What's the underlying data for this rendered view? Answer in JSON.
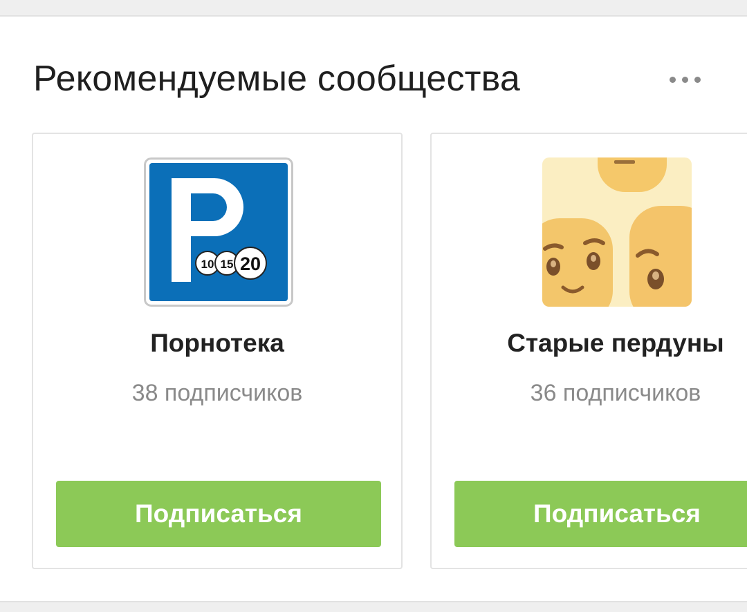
{
  "section": {
    "title": "Рекомендуемые сообщества",
    "more_icon": "more-horizontal-icon"
  },
  "communities": [
    {
      "name": "Порнотека",
      "subscribers": "38 подписчиков",
      "button_label": "Подписаться",
      "avatar": {
        "icon": "parking-sign-icon",
        "letter": "P",
        "badges": [
          "10",
          "15",
          "20"
        ],
        "color": "#0b6fb8"
      }
    },
    {
      "name": "Старые пердуны",
      "subscribers": "36 подписчиков",
      "button_label": "Подписаться",
      "avatar": {
        "icon": "cartoon-faces-icon",
        "color": "#f5d27a"
      }
    }
  ],
  "colors": {
    "button": "#8cc957",
    "title": "#1f1f1f",
    "muted": "#8a8a8a",
    "border": "#e3e3e3"
  }
}
